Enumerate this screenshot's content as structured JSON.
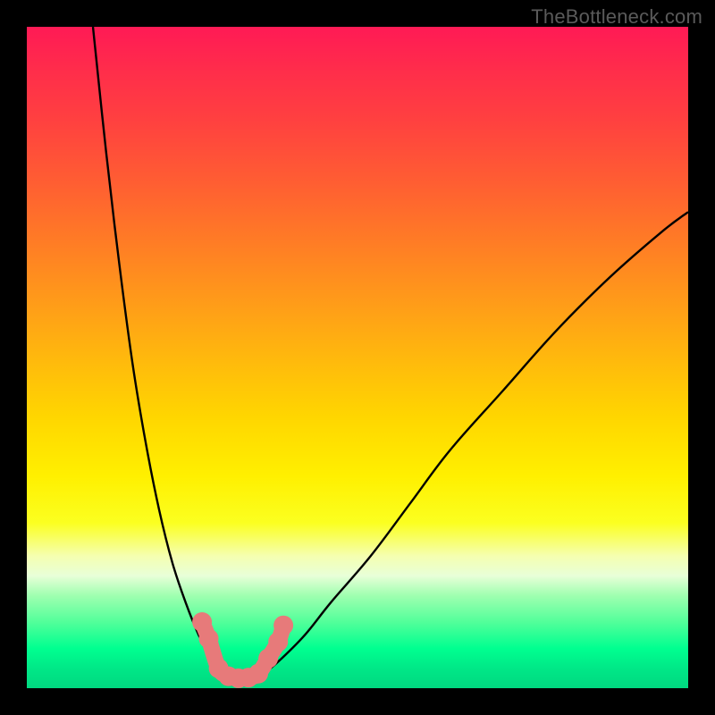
{
  "watermark": "TheBottleneck.com",
  "chart_data": {
    "type": "line",
    "title": "",
    "xlabel": "",
    "ylabel": "",
    "xlim": [
      0,
      100
    ],
    "ylim": [
      0,
      100
    ],
    "grid": false,
    "legend": false,
    "colors": {
      "gradient_top": "#ff1a55",
      "gradient_mid": "#ffd600",
      "gradient_bottom": "#00d880",
      "curve": "#000000",
      "marker": "#e77a7a",
      "frame": "#000000"
    },
    "series": [
      {
        "name": "left_branch",
        "x": [
          10,
          12,
          14,
          16,
          18,
          20,
          22,
          24,
          26,
          28,
          29.5
        ],
        "values": [
          100,
          81,
          64,
          49,
          37,
          27,
          19,
          13,
          8,
          4,
          1.5
        ]
      },
      {
        "name": "right_branch",
        "x": [
          35,
          38,
          42,
          46,
          52,
          58,
          64,
          72,
          80,
          88,
          96,
          100
        ],
        "values": [
          1.5,
          4,
          8,
          13,
          20,
          28,
          36,
          45,
          54,
          62,
          69,
          72
        ]
      }
    ],
    "markers": {
      "name": "bottom_cluster",
      "points": [
        {
          "x": 26.5,
          "y": 10
        },
        {
          "x": 27.5,
          "y": 7.5
        },
        {
          "x": 29.0,
          "y": 3.0
        },
        {
          "x": 30.5,
          "y": 1.8
        },
        {
          "x": 32.0,
          "y": 1.5
        },
        {
          "x": 33.5,
          "y": 1.6
        },
        {
          "x": 35.0,
          "y": 2.2
        },
        {
          "x": 36.5,
          "y": 4.5
        },
        {
          "x": 38.0,
          "y": 7.0
        },
        {
          "x": 38.8,
          "y": 9.5
        }
      ]
    }
  }
}
